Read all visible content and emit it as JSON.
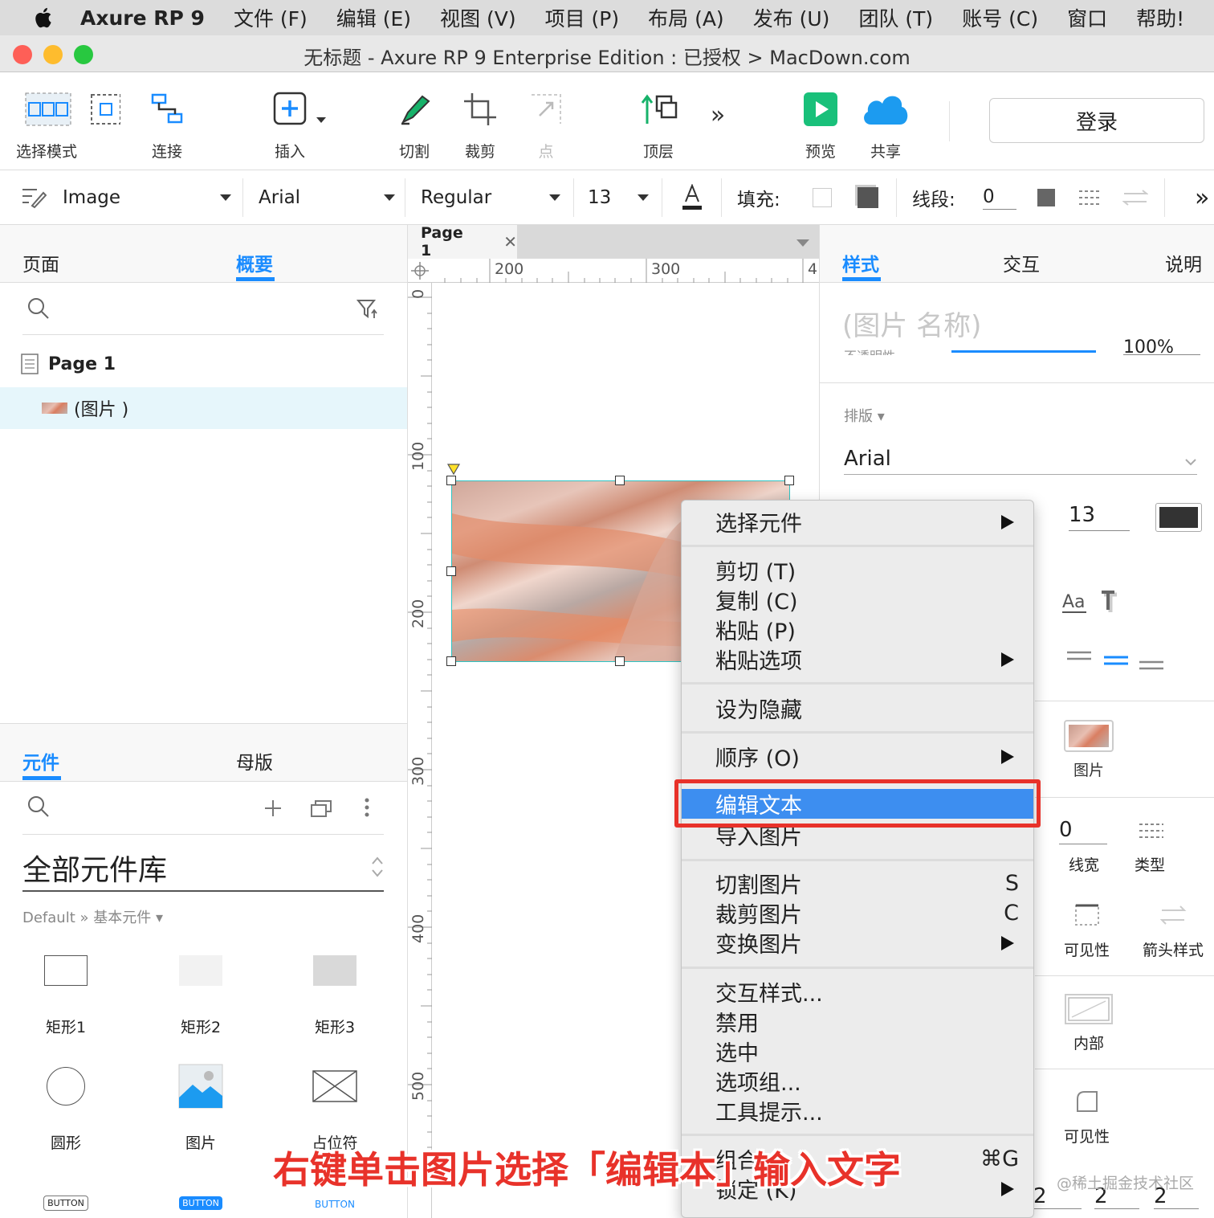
{
  "menubar": {
    "app": "Axure RP 9",
    "items": [
      "文件 (F)",
      "编辑 (E)",
      "视图 (V)",
      "项目 (P)",
      "布局 (A)",
      "发布 (U)",
      "团队 (T)",
      "账号 (C)",
      "窗口",
      "帮助!"
    ]
  },
  "window": {
    "title": "无标题 - Axure RP 9 Enterprise Edition : 已授权 > MacDown.com"
  },
  "toolbar": {
    "select_mode": "选择模式",
    "connect": "连接",
    "insert": "插入",
    "slice": "切割",
    "crop": "裁剪",
    "point": "点",
    "top": "顶层",
    "preview": "预览",
    "share": "共享",
    "login": "登录",
    "more": "»"
  },
  "stylebar": {
    "style_name": "Image",
    "font": "Arial",
    "weight": "Regular",
    "size": "13",
    "fill_label": "填充:",
    "line_label": "线段:",
    "line_value": "0",
    "more": "»"
  },
  "left": {
    "tabs": {
      "pages": "页面",
      "outline": "概要"
    },
    "outline": {
      "page": "Page 1",
      "item": "(图片 )"
    },
    "lib_tabs": {
      "widgets": "元件",
      "masters": "母版"
    },
    "library_name": "全部元件库",
    "library_path": "Default » 基本元件 ▾",
    "widgets": [
      {
        "label": "矩形1"
      },
      {
        "label": "矩形2"
      },
      {
        "label": "矩形3"
      },
      {
        "label": "圆形"
      },
      {
        "label": "图片"
      },
      {
        "label": "占位符"
      },
      {
        "label": "BUTTON"
      },
      {
        "label": "BUTTON"
      },
      {
        "label": "BUTTON"
      }
    ]
  },
  "canvas": {
    "page_tab": "Page 1",
    "hruler": [
      "200",
      "300",
      "4"
    ],
    "vruler": [
      "0",
      "100",
      "200",
      "300",
      "400",
      "500"
    ]
  },
  "right": {
    "tabs": {
      "style": "样式",
      "interact": "交互",
      "notes": "说明"
    },
    "name_placeholder": "(图片 名称)",
    "opacity_label": "不透明性",
    "opacity_value": "100%",
    "typography_label": "排版 ▾",
    "font": "Arial",
    "font_size": "13",
    "image_label": "图片",
    "line_width_value": "0",
    "line_width_label": "线宽",
    "line_type_label": "类型",
    "visibility_label": "可见性",
    "arrow_label": "箭头样式",
    "inner_label": "内部",
    "corner_label": "可见性",
    "padding": [
      "2",
      "2",
      "2"
    ]
  },
  "context_menu": {
    "items": [
      {
        "label": "选择元件",
        "submenu": true
      },
      {
        "label": "剪切 (T)"
      },
      {
        "label": "复制 (C)"
      },
      {
        "label": "粘贴 (P)"
      },
      {
        "label": "粘贴选项",
        "submenu": true
      },
      {
        "label": "设为隐藏"
      },
      {
        "label": "顺序 (O)",
        "submenu": true
      },
      {
        "label": "编辑文本",
        "highlighted": true
      },
      {
        "label": "导入图片"
      },
      {
        "label": "切割图片",
        "shortcut": "S"
      },
      {
        "label": "裁剪图片",
        "shortcut": "C"
      },
      {
        "label": "变换图片",
        "submenu": true
      },
      {
        "label": "交互样式..."
      },
      {
        "label": "禁用"
      },
      {
        "label": "选中"
      },
      {
        "label": "选项组..."
      },
      {
        "label": "工具提示..."
      },
      {
        "label": "组合",
        "shortcut": "⌘G"
      },
      {
        "label": "锁定 (K)",
        "submenu": true
      }
    ]
  },
  "caption": "右键单击图片选择「编辑本」输入文字",
  "watermark": "@稀土掘金技术社区",
  "colors": {
    "accent": "#1a8cff",
    "highlight": "#3d8ef0",
    "annotation_red": "#e8322a",
    "preview_green": "#19c07a",
    "share_blue": "#1c9bf0"
  }
}
